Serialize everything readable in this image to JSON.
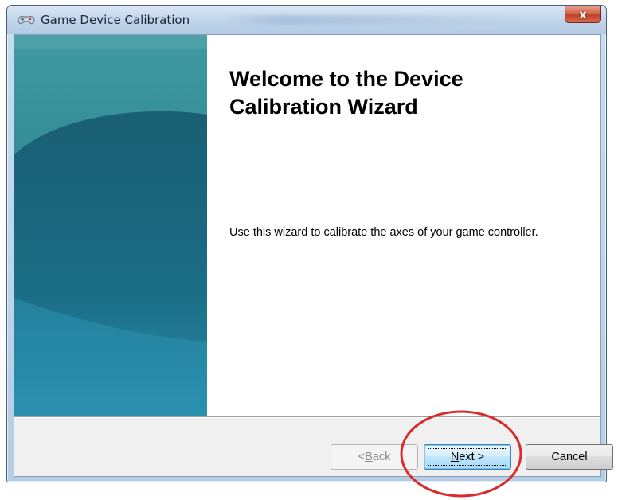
{
  "window": {
    "title": "Game Device Calibration",
    "title_icon": "game-controller-icon",
    "close_glyph": "x"
  },
  "wizard": {
    "heading": "Welcome to the Device Calibration Wizard",
    "description": "Use this wizard to calibrate the axes of your game controller."
  },
  "buttons": {
    "back": {
      "prefix": "< ",
      "mnemonic": "B",
      "rest": "ack",
      "enabled": false
    },
    "next": {
      "mnemonic": "N",
      "rest": "ext >",
      "focused": true
    },
    "cancel": {
      "label": "Cancel"
    }
  },
  "colors": {
    "side_panel": "#1f7683",
    "annotation": "#d92b2b",
    "close_button": "#c0402a"
  }
}
